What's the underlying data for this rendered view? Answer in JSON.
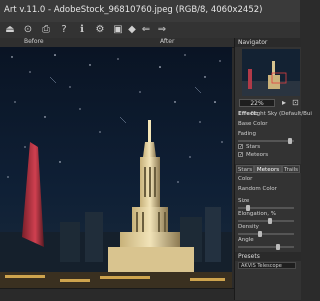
{
  "window": {
    "title": "Art v.11.0 - AdobeStock_96810760.jpeg (RGB/8, 4060x2452)"
  },
  "toolbar": {
    "icons": [
      "open-icon",
      "save-icon",
      "print-icon",
      "help-icon",
      "info-icon",
      "settings-icon",
      "photo-icon",
      "before-icon",
      "undo-icon",
      "redo-icon"
    ]
  },
  "before_after": {
    "before_label": "Before",
    "after_label": "After"
  },
  "navigator": {
    "title": "Navigator",
    "zoom": "22%"
  },
  "settings": {
    "effect_label": "Effect:",
    "effect_value": "Night Sky (Default/Bui",
    "base_color": "Base Color",
    "fading": "Fading",
    "stars": "Stars",
    "meteors": "Meteors",
    "tabs": [
      "Stars",
      "Meteors",
      "Trails"
    ],
    "active_tab": 1,
    "color": "Color",
    "random_color": "Random Color",
    "size": "Size",
    "elongation": "Elongation, %",
    "density": "Density",
    "angle": "Angle",
    "presets_title": "Presets",
    "preset_value": "AKVIS Telescope"
  }
}
